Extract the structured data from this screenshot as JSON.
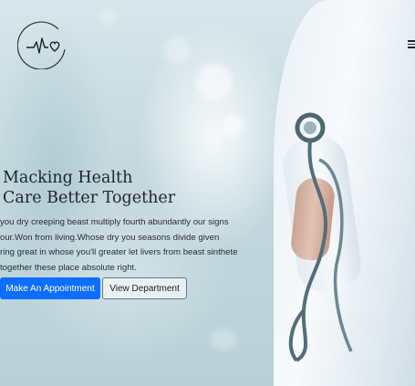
{
  "hero": {
    "title_line1": "Macking Health",
    "title_line2": "Care Better Together",
    "description_lines": [
      "you dry creeping beast multiply fourth abundantly our signs",
      "our.Won from living.Whose dry you seasons divide given",
      "ring great in whose you'll greater let livers from beast sinthete",
      "together these place absolute right."
    ],
    "primary_button": "Make An Appointment",
    "secondary_button": "View Department"
  },
  "icons": {
    "logo": "heartbeat-heart-logo",
    "menu": "hamburger-menu-icon"
  },
  "colors": {
    "primary": "#0d6efd",
    "heading": "#1f2328"
  }
}
